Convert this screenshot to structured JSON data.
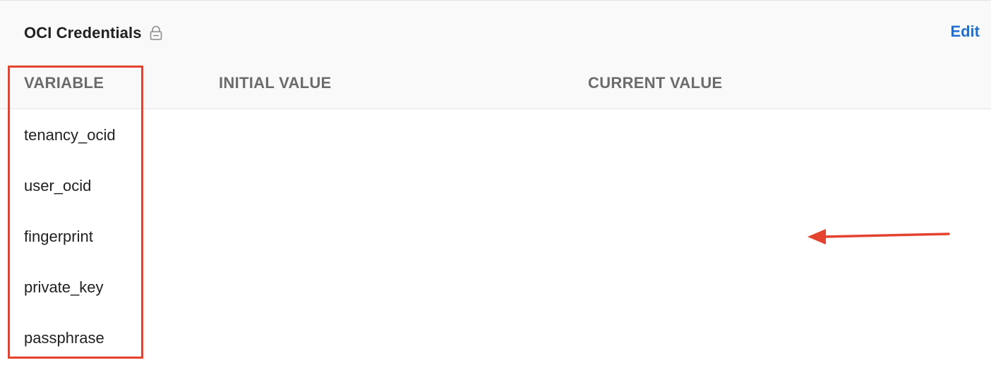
{
  "header": {
    "title": "OCI Credentials",
    "lock_icon": "lock-icon",
    "edit_label": "Edit"
  },
  "table": {
    "columns": [
      "VARIABLE",
      "INITIAL VALUE",
      "CURRENT VALUE"
    ],
    "rows": [
      {
        "variable": "tenancy_ocid",
        "initial_value": "",
        "current_value": ""
      },
      {
        "variable": "user_ocid",
        "initial_value": "",
        "current_value": ""
      },
      {
        "variable": "fingerprint",
        "initial_value": "",
        "current_value": ""
      },
      {
        "variable": "private_key",
        "initial_value": "",
        "current_value": ""
      },
      {
        "variable": "passphrase",
        "initial_value": "",
        "current_value": ""
      }
    ]
  },
  "annotations": {
    "highlight_color": "#e4432f",
    "arrow_color": "#e4432f",
    "arrow_icon": "arrow-left-icon"
  },
  "colors": {
    "link": "#1f6fd1",
    "header_text": "#6b6b6b",
    "body_text": "#212121",
    "header_background": "#f9f9f9"
  }
}
